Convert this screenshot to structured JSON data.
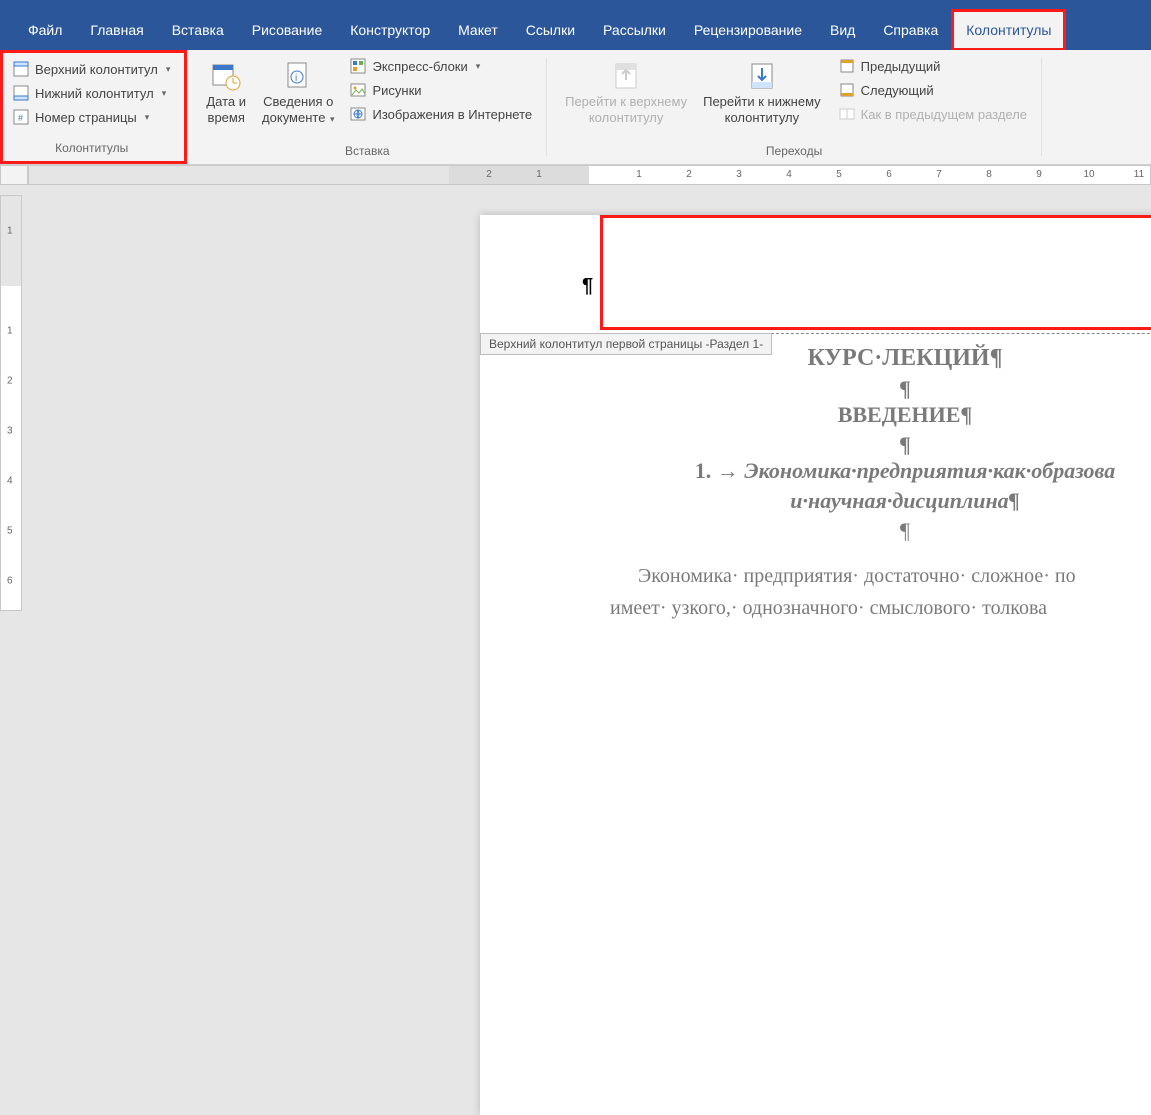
{
  "tabs": [
    "Файл",
    "Главная",
    "Вставка",
    "Рисование",
    "Конструктор",
    "Макет",
    "Ссылки",
    "Рассылки",
    "Рецензирование",
    "Вид",
    "Справка",
    "Колонтитулы"
  ],
  "active_tab": "Колонтитулы",
  "ribbon": {
    "headers_footers": {
      "label": "Колонтитулы",
      "header": "Верхний колонтитул",
      "footer": "Нижний колонтитул",
      "page_number": "Номер страницы"
    },
    "insert": {
      "label": "Вставка",
      "date_time_l1": "Дата и",
      "date_time_l2": "время",
      "doc_info_l1": "Сведения о",
      "doc_info_l2": "документе",
      "quick_parts": "Экспресс-блоки",
      "pictures": "Рисунки",
      "online_pics": "Изображения в Интернете"
    },
    "nav": {
      "label": "Переходы",
      "goto_header_l1": "Перейти к верхнему",
      "goto_header_l2": "колонтитулу",
      "goto_footer_l1": "Перейти к нижнему",
      "goto_footer_l2": "колонтитулу",
      "previous": "Предыдущий",
      "next": "Следующий",
      "link_prev": "Как в предыдущем разделе"
    }
  },
  "hruler_numbers": [
    "2",
    "1",
    "",
    "1",
    "2",
    "3",
    "4",
    "5",
    "6",
    "7",
    "8",
    "9",
    "10",
    "11"
  ],
  "vruler_numbers": [
    "1",
    "",
    "1",
    "2",
    "3",
    "4",
    "5",
    "6"
  ],
  "header_tag": "Верхний колонтитул первой страницы -Раздел 1-",
  "doc": {
    "title": "КУРС·ЛЕКЦИЙ¶",
    "intro": "ВВЕДЕНИЕ¶",
    "section_num": "1.  → ",
    "section_a": "Экономика·предприятия·как·образова",
    "section_b": "и·научная·дисциплина¶",
    "para1": "Экономика· предприятия· достаточно· сложное· по",
    "para2": "имеет· узкого,· однозначного· смыслового· толкова"
  }
}
